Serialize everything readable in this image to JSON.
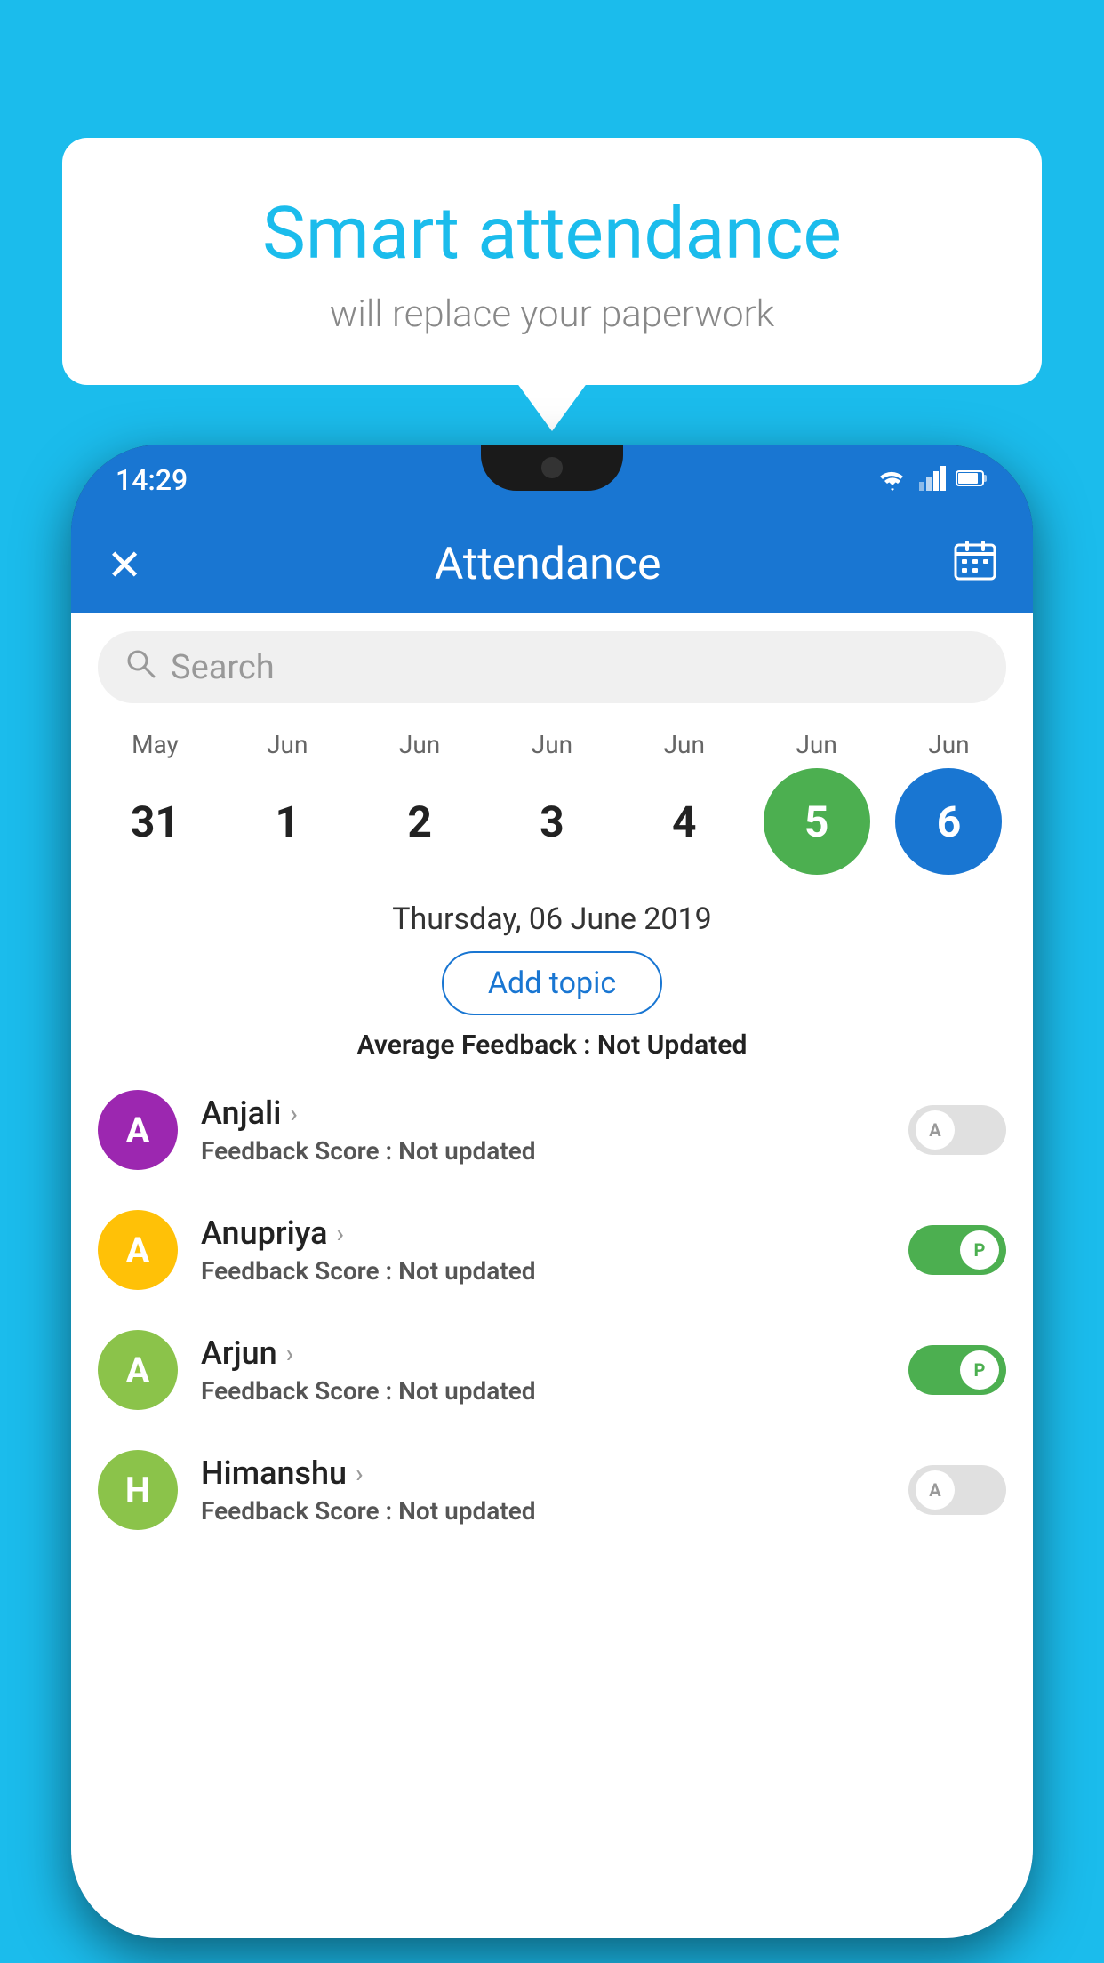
{
  "background_color": "#1BBCEC",
  "speech_bubble": {
    "title": "Smart attendance",
    "subtitle": "will replace your paperwork"
  },
  "phone": {
    "status_bar": {
      "time": "14:29",
      "wifi": "▾",
      "signal": "▴",
      "battery": "▮"
    },
    "app_bar": {
      "title": "Attendance",
      "close_icon": "✕",
      "calendar_icon": "📅"
    },
    "search": {
      "placeholder": "Search"
    },
    "calendar": {
      "months": [
        "May",
        "Jun",
        "Jun",
        "Jun",
        "Jun",
        "Jun",
        "Jun"
      ],
      "dates": [
        "31",
        "1",
        "2",
        "3",
        "4",
        "5",
        "6"
      ],
      "today_index": 5,
      "selected_index": 6
    },
    "selected_date": {
      "text": "Thursday, 06 June 2019",
      "add_topic_label": "Add topic",
      "avg_feedback_label": "Average Feedback : ",
      "avg_feedback_value": "Not Updated"
    },
    "students": [
      {
        "name": "Anjali",
        "avatar_letter": "A",
        "avatar_color": "#9C27B0",
        "feedback_label": "Feedback Score : ",
        "feedback_value": "Not updated",
        "attendance": "absent",
        "toggle_label": "A"
      },
      {
        "name": "Anupriya",
        "avatar_letter": "A",
        "avatar_color": "#FFC107",
        "feedback_label": "Feedback Score : ",
        "feedback_value": "Not updated",
        "attendance": "present",
        "toggle_label": "P"
      },
      {
        "name": "Arjun",
        "avatar_letter": "A",
        "avatar_color": "#8BC34A",
        "feedback_label": "Feedback Score : ",
        "feedback_value": "Not updated",
        "attendance": "present",
        "toggle_label": "P"
      },
      {
        "name": "Himanshu",
        "avatar_letter": "H",
        "avatar_color": "#8BC34A",
        "feedback_label": "Feedback Score : ",
        "feedback_value": "Not updated",
        "attendance": "absent",
        "toggle_label": "A"
      }
    ]
  }
}
